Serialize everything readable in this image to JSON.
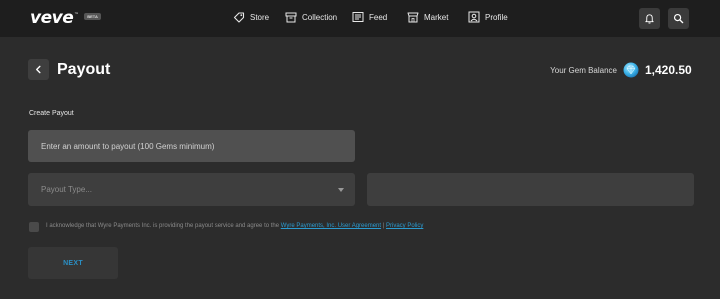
{
  "header": {
    "logo_text": "veve",
    "logo_tm": "™",
    "logo_badge": "BETA",
    "nav": [
      {
        "label": "Store",
        "icon": "store-tag-icon"
      },
      {
        "label": "Collection",
        "icon": "collection-box-icon"
      },
      {
        "label": "Feed",
        "icon": "feed-icon"
      },
      {
        "label": "Market",
        "icon": "market-icon"
      },
      {
        "label": "Profile",
        "icon": "profile-icon"
      }
    ],
    "actions": [
      {
        "icon": "bell-icon"
      },
      {
        "icon": "search-icon"
      }
    ]
  },
  "page": {
    "title": "Payout",
    "balance_label": "Your Gem Balance",
    "balance_value": "1,420.50"
  },
  "form": {
    "section_label": "Create Payout",
    "amount_placeholder": "Enter an amount to payout (100 Gems minimum)",
    "payout_type_placeholder": "Payout Type...",
    "ack_text": "I acknowledge that Wyre Payments Inc. is providing the payout service and agree to the",
    "ack_link_1": "Wyre Payments, Inc. User Agreement",
    "ack_separator": "|",
    "ack_link_2": "Privacy Policy",
    "next_label": "NEXT"
  },
  "colors": {
    "background": "#2c2c2c",
    "topbar": "#1e1e1e",
    "accent": "#2b9bd0"
  }
}
